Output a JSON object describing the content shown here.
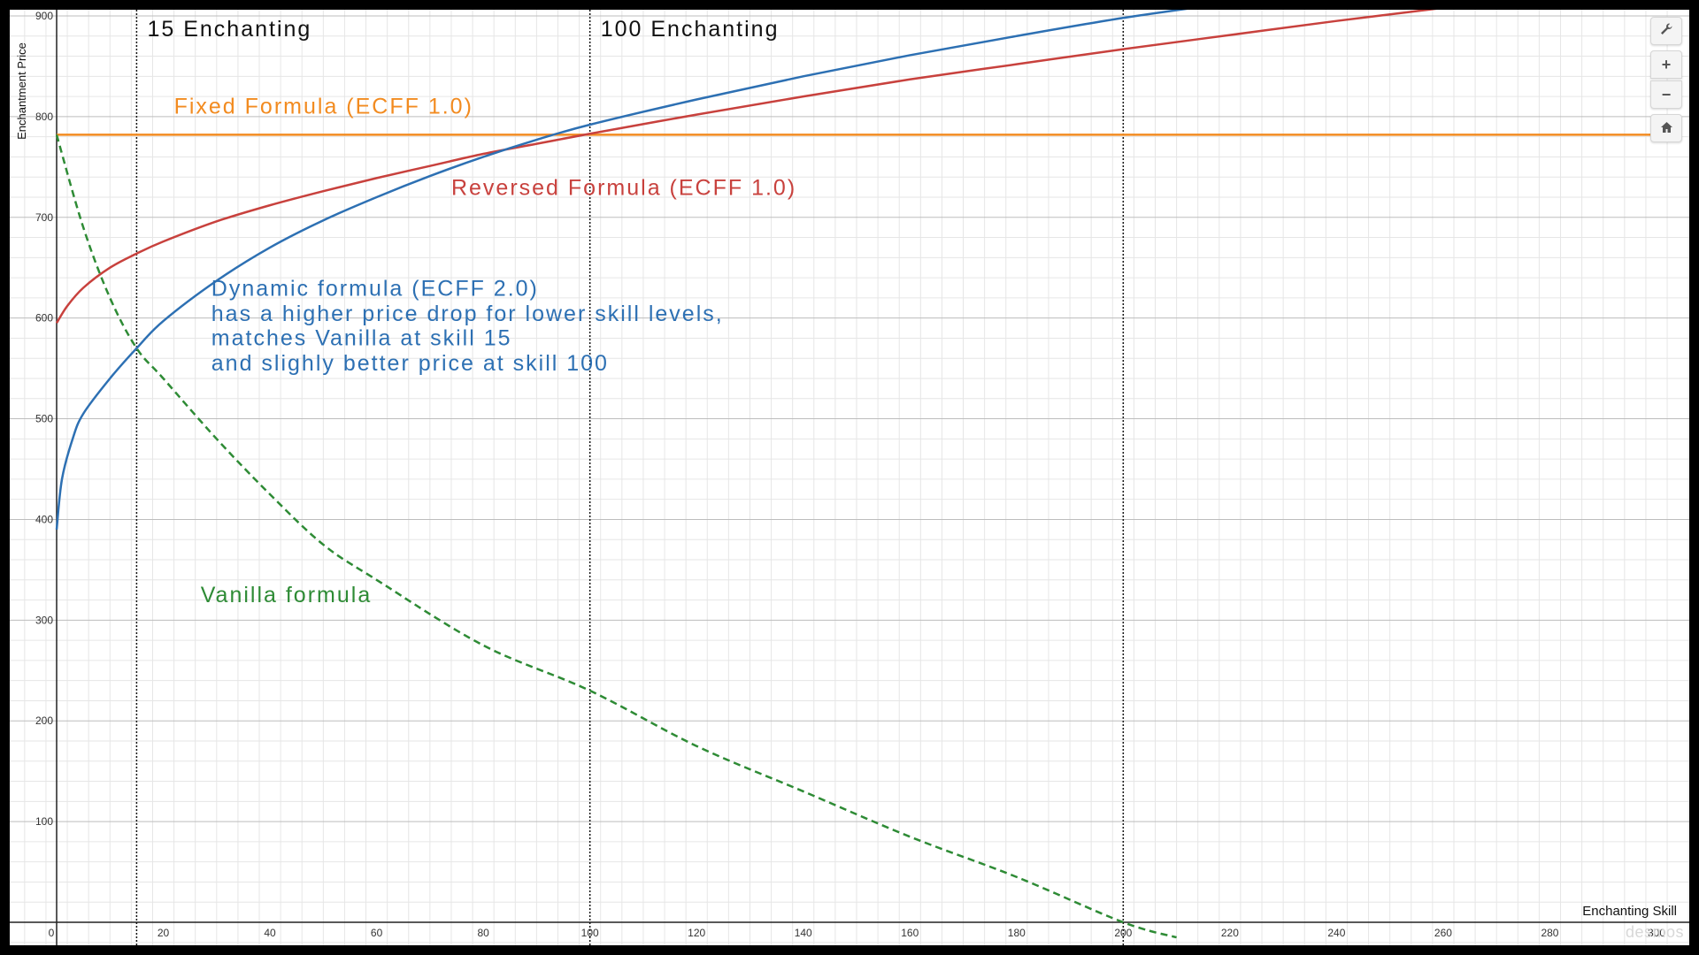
{
  "chart_data": {
    "type": "line",
    "xlabel": "Enchanting Skill",
    "ylabel": "Enchantment Price",
    "xlim": [
      0,
      300
    ],
    "ylim": [
      0,
      900
    ],
    "x_ticks": [
      0,
      20,
      40,
      60,
      80,
      100,
      120,
      140,
      160,
      180,
      200,
      220,
      240,
      260,
      280,
      300
    ],
    "y_ticks": [
      100,
      200,
      300,
      400,
      500,
      600,
      700,
      800,
      900
    ],
    "grid": true,
    "series": [
      {
        "key": "fixed",
        "color": "#f28b20",
        "dash": false,
        "x": [
          0,
          300
        ],
        "y": [
          782,
          782
        ]
      },
      {
        "key": "reversed",
        "color": "#c8413d",
        "dash": false,
        "x": [
          0,
          2,
          5,
          10,
          15,
          20,
          30,
          40,
          50,
          60,
          70,
          80,
          90,
          100,
          120,
          140,
          160,
          180,
          200,
          220,
          240,
          260,
          262
        ],
        "y": [
          595,
          612,
          630,
          650,
          664,
          676,
          696,
          712,
          726,
          739,
          751,
          763,
          773,
          783,
          802,
          820,
          837,
          852,
          867,
          881,
          895,
          908,
          910
        ]
      },
      {
        "key": "dynamic",
        "color": "#2d70b3",
        "dash": false,
        "x": [
          0,
          1,
          3,
          5,
          10,
          15,
          20,
          30,
          40,
          50,
          60,
          70,
          80,
          90,
          100,
          120,
          140,
          160,
          180,
          200,
          220
        ],
        "y": [
          390,
          440,
          480,
          505,
          540,
          570,
          597,
          637,
          670,
          697,
          720,
          741,
          760,
          777,
          792,
          817,
          840,
          861,
          880,
          898,
          913
        ]
      },
      {
        "key": "vanilla",
        "color": "#2e8b35",
        "dash": true,
        "x": [
          0,
          5,
          10,
          15,
          20,
          30,
          40,
          50,
          60,
          80,
          100,
          120,
          140,
          160,
          180,
          200,
          210
        ],
        "y": [
          782,
          690,
          620,
          570,
          540,
          480,
          425,
          375,
          340,
          275,
          230,
          175,
          130,
          85,
          45,
          0,
          -15
        ]
      }
    ],
    "vlines": [
      15,
      100,
      200
    ],
    "annotations": [
      {
        "key": "15",
        "text": "15 Enchanting",
        "x": 17,
        "y": 880,
        "color": "#111111"
      },
      {
        "key": "100",
        "text": "100 Enchanting",
        "x": 102,
        "y": 880,
        "color": "#111111"
      },
      {
        "key": "fixed",
        "text": "Fixed Formula (ECFF 1.0)",
        "x": 22,
        "y": 803,
        "color": "#f28b20"
      },
      {
        "key": "reversed",
        "text": "Reversed Formula (ECFF 1.0)",
        "x": 74,
        "y": 722,
        "color": "#c8413d"
      },
      {
        "key": "dyn1",
        "text": "Dynamic formula (ECFF 2.0)",
        "x": 29,
        "y": 622,
        "color": "#2d70b3"
      },
      {
        "key": "dyn2",
        "text": "has a higher price drop for lower skill levels,",
        "x": 29,
        "y": 597,
        "color": "#2d70b3"
      },
      {
        "key": "dyn3",
        "text": "matches Vanilla at skill 15",
        "x": 29,
        "y": 573,
        "color": "#2d70b3"
      },
      {
        "key": "dyn4",
        "text": "and slighly better price at skill 100",
        "x": 29,
        "y": 548,
        "color": "#2d70b3"
      },
      {
        "key": "vanilla",
        "text": "Vanilla formula",
        "x": 27,
        "y": 318,
        "color": "#2e8b35"
      }
    ]
  },
  "toolbar": {
    "settings_icon": "wrench-icon",
    "zoom_in_label": "+",
    "zoom_out_label": "−",
    "home_icon": "home-icon"
  },
  "watermark": "desmos"
}
